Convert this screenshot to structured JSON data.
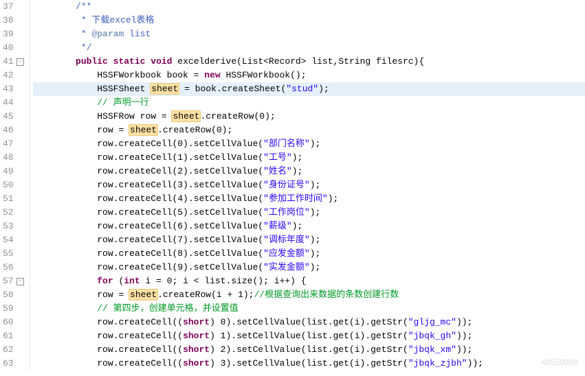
{
  "startLine": 37,
  "lines": [
    {
      "n": 37,
      "ind": 8,
      "parts": [
        {
          "t": "/**",
          "c": "javadoc"
        }
      ]
    },
    {
      "n": 38,
      "ind": 9,
      "parts": [
        {
          "t": "* 下载excel表格",
          "c": "javadoc"
        }
      ]
    },
    {
      "n": 39,
      "ind": 9,
      "parts": [
        {
          "t": "* ",
          "c": "javadoc"
        },
        {
          "t": "@param",
          "c": "javadoc-tag"
        },
        {
          "t": " list",
          "c": "javadoc"
        }
      ]
    },
    {
      "n": 40,
      "ind": 9,
      "parts": [
        {
          "t": "*/",
          "c": "javadoc"
        }
      ]
    },
    {
      "n": 41,
      "ind": 8,
      "fold": true,
      "parts": [
        {
          "t": "public",
          "c": "kw"
        },
        {
          "t": " "
        },
        {
          "t": "static",
          "c": "kw"
        },
        {
          "t": " "
        },
        {
          "t": "void",
          "c": "kw"
        },
        {
          "t": " excelderive(List<Record> list,String filesrc){"
        }
      ]
    },
    {
      "n": 42,
      "ind": 12,
      "parts": [
        {
          "t": "HSSFWorkbook book = "
        },
        {
          "t": "new",
          "c": "kw"
        },
        {
          "t": " HSSFWorkbook();"
        }
      ]
    },
    {
      "n": 43,
      "ind": 12,
      "highlight": true,
      "parts": [
        {
          "t": "HSSFSheet "
        },
        {
          "t": "sheet",
          "c": "occ",
          "caret": true
        },
        {
          "t": " = book.createSheet("
        },
        {
          "t": "\"stud\"",
          "c": "str"
        },
        {
          "t": ");"
        }
      ]
    },
    {
      "n": 44,
      "ind": 12,
      "parts": [
        {
          "t": "// 声明一行",
          "c": "comment-line"
        }
      ]
    },
    {
      "n": 45,
      "ind": 12,
      "parts": [
        {
          "t": "HSSFRow row = "
        },
        {
          "t": "sheet",
          "c": "occ"
        },
        {
          "t": ".createRow(0);"
        }
      ]
    },
    {
      "n": 46,
      "ind": 12,
      "parts": [
        {
          "t": "row = "
        },
        {
          "t": "sheet",
          "c": "occ"
        },
        {
          "t": ".createRow(0);"
        }
      ]
    },
    {
      "n": 47,
      "ind": 12,
      "parts": [
        {
          "t": "row.createCell(0).setCellValue("
        },
        {
          "t": "\"部门名称\"",
          "c": "str"
        },
        {
          "t": ");"
        }
      ]
    },
    {
      "n": 48,
      "ind": 12,
      "parts": [
        {
          "t": "row.createCell(1).setCellValue("
        },
        {
          "t": "\"工号\"",
          "c": "str"
        },
        {
          "t": ");"
        }
      ]
    },
    {
      "n": 49,
      "ind": 12,
      "parts": [
        {
          "t": "row.createCell(2).setCellValue("
        },
        {
          "t": "\"姓名\"",
          "c": "str"
        },
        {
          "t": ");"
        }
      ]
    },
    {
      "n": 50,
      "ind": 12,
      "parts": [
        {
          "t": "row.createCell(3).setCellValue("
        },
        {
          "t": "\"身份证号\"",
          "c": "str"
        },
        {
          "t": ");"
        }
      ]
    },
    {
      "n": 51,
      "ind": 12,
      "parts": [
        {
          "t": "row.createCell(4).setCellValue("
        },
        {
          "t": "\"参加工作时间\"",
          "c": "str"
        },
        {
          "t": ");"
        }
      ]
    },
    {
      "n": 52,
      "ind": 12,
      "parts": [
        {
          "t": "row.createCell(5).setCellValue("
        },
        {
          "t": "\"工作岗位\"",
          "c": "str"
        },
        {
          "t": ");"
        }
      ]
    },
    {
      "n": 53,
      "ind": 12,
      "parts": [
        {
          "t": "row.createCell(6).setCellValue("
        },
        {
          "t": "\"薪级\"",
          "c": "str"
        },
        {
          "t": ");"
        }
      ]
    },
    {
      "n": 54,
      "ind": 12,
      "parts": [
        {
          "t": "row.createCell(7).setCellValue("
        },
        {
          "t": "\"调标年度\"",
          "c": "str"
        },
        {
          "t": ");"
        }
      ]
    },
    {
      "n": 55,
      "ind": 12,
      "parts": [
        {
          "t": "row.createCell(8).setCellValue("
        },
        {
          "t": "\"应发金额\"",
          "c": "str"
        },
        {
          "t": ");"
        }
      ]
    },
    {
      "n": 56,
      "ind": 12,
      "parts": [
        {
          "t": "row.createCell(9).setCellValue("
        },
        {
          "t": "\"实发金额\"",
          "c": "str"
        },
        {
          "t": ");"
        }
      ]
    },
    {
      "n": 57,
      "ind": 12,
      "fold": true,
      "parts": [
        {
          "t": "for",
          "c": "kw"
        },
        {
          "t": " ("
        },
        {
          "t": "int",
          "c": "kw"
        },
        {
          "t": " i = 0; i < list.size(); i++) {"
        }
      ]
    },
    {
      "n": 58,
      "ind": 12,
      "parts": [
        {
          "t": "row = "
        },
        {
          "t": "sheet",
          "c": "occ"
        },
        {
          "t": ".createRow(i + 1);"
        },
        {
          "t": "//根据查询出来数据的条数创建行数",
          "c": "comment-line"
        }
      ]
    },
    {
      "n": 59,
      "ind": 12,
      "parts": [
        {
          "t": "// 第四步，创建单元格，并设置值",
          "c": "comment-line"
        }
      ]
    },
    {
      "n": 60,
      "ind": 12,
      "parts": [
        {
          "t": "row.createCell(("
        },
        {
          "t": "short",
          "c": "kw"
        },
        {
          "t": ") 0).setCellValue(list.get(i).getStr("
        },
        {
          "t": "\"gljg_mc\"",
          "c": "str"
        },
        {
          "t": "));"
        }
      ]
    },
    {
      "n": 61,
      "ind": 12,
      "parts": [
        {
          "t": "row.createCell(("
        },
        {
          "t": "short",
          "c": "kw"
        },
        {
          "t": ") 1).setCellValue(list.get(i).getStr("
        },
        {
          "t": "\"jbqk_gh\"",
          "c": "str"
        },
        {
          "t": "));"
        }
      ]
    },
    {
      "n": 62,
      "ind": 12,
      "parts": [
        {
          "t": "row.createCell(("
        },
        {
          "t": "short",
          "c": "kw"
        },
        {
          "t": ") 2).setCellValue(list.get(i).getStr("
        },
        {
          "t": "\"jbqk_xm\"",
          "c": "str"
        },
        {
          "t": "));"
        }
      ]
    },
    {
      "n": 63,
      "ind": 12,
      "parts": [
        {
          "t": "row.createCell(("
        },
        {
          "t": "short",
          "c": "kw"
        },
        {
          "t": ") 3).setCellValue(list.get(i).getStr("
        },
        {
          "t": "\"jbqk_zjbh\"",
          "c": "str"
        },
        {
          "t": "));"
        }
      ]
    }
  ],
  "watermark": "48550898"
}
